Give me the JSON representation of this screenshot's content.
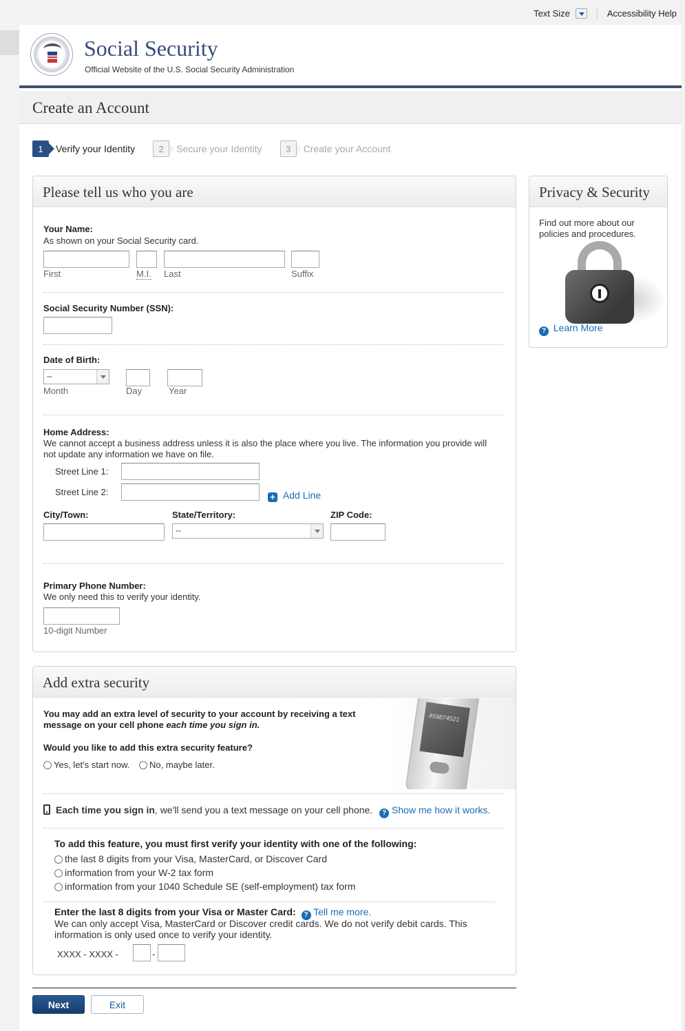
{
  "utility": {
    "text_size": "Text Size",
    "accessibility_help": "Accessibility Help"
  },
  "brand": {
    "title": "Social Security",
    "subtitle": "Official Website of the U.S. Social Security Administration"
  },
  "page_title": "Create an Account",
  "steps": [
    {
      "num": "1",
      "label": "Verify your Identity",
      "active": true
    },
    {
      "num": "2",
      "label": "Secure your Identity",
      "active": false
    },
    {
      "num": "3",
      "label": "Create your Account",
      "active": false
    }
  ],
  "identity_panel": {
    "title": "Please tell us who you are",
    "name": {
      "label": "Your Name:",
      "hint": "As shown on your Social Security card.",
      "first": "First",
      "mi": "M.I.",
      "last": "Last",
      "suffix": "Suffix"
    },
    "ssn": {
      "label": "Social Security Number (SSN):"
    },
    "dob": {
      "label": "Date of Birth:",
      "month_value": "--",
      "month": "Month",
      "day": "Day",
      "year": "Year"
    },
    "address": {
      "label": "Home Address:",
      "hint": "We cannot accept a business address unless it is also the place where you live. The information you provide will not update any information we have on file.",
      "street1": "Street Line 1:",
      "street2": "Street Line 2:",
      "add_line": "Add Line",
      "city": "City/Town:",
      "state": "State/Territory:",
      "state_value": "--",
      "zip": "ZIP Code:"
    },
    "phone": {
      "label": "Primary Phone Number:",
      "hint": "We only need this to verify your identity.",
      "caption": "10-digit Number"
    }
  },
  "privacy_panel": {
    "title": "Privacy & Security",
    "text": "Find out more about our policies and procedures.",
    "learn_more": "Learn More"
  },
  "security_panel": {
    "title": "Add extra security",
    "intro_a": "You may add an extra level of security to your account by receiving a text message on your cell phone ",
    "intro_b": "each time you sign in.",
    "question": "Would you like to add this extra security feature?",
    "yes": "Yes, let's start now.",
    "no": "No, maybe later.",
    "phone_code": "459874521",
    "each_time_bold": "Each time you sign in",
    "each_time_rest": ", we'll send you a text message on your cell phone.",
    "show_me": "Show me how it works.",
    "verify_label": "To add this feature, you must first verify your identity with one of the following:",
    "options": [
      "the last 8 digits from your Visa, MasterCard, or Discover Card",
      "information from your W-2 tax form",
      "information from your 1040 Schedule SE (self-employment) tax form"
    ],
    "card_label": "Enter the last 8 digits from your Visa or Master Card:",
    "tell_me": "Tell me more.",
    "card_hint": "We can only accept Visa, MasterCard or Discover credit cards. We do not verify debit cards. This information is only used once to verify your identity.",
    "card_mask": "XXXX - XXXX -",
    "dash": "-"
  },
  "buttons": {
    "next": "Next",
    "exit": "Exit"
  }
}
